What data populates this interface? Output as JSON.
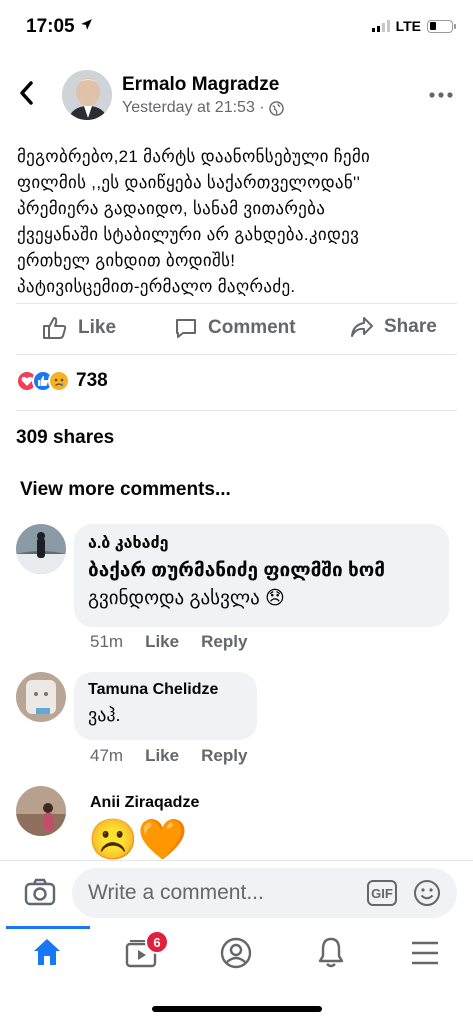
{
  "status": {
    "time": "17:05",
    "network": "LTE"
  },
  "post": {
    "author": "Ermalo Magradze",
    "timestamp": "Yesterday at 21:53 ·",
    "text_lines": [
      "მეგობრებო,21 მარტს დაანონსებული ჩემი",
      "ფილმის ,,ეს დაიწყება საქართველოდან''",
      "პრემიერა გადაიდო, სანამ ვითარება",
      "ქვეყანაში  სტაბილური არ გახდება.კიდევ",
      "ერთხელ  გიხდით ბოდიშს!",
      "პატივისცემით-ერმალო მაღრაძე."
    ]
  },
  "actions": {
    "like": "Like",
    "comment": "Comment",
    "share": "Share"
  },
  "stats": {
    "reaction_count": "738",
    "shares": "309 shares"
  },
  "view_more": "View more comments...",
  "comments": [
    {
      "name": "ა.ბ კახაძე",
      "text_line1": "ბაქარ თურმანიძე ფილმში ხომ",
      "text_line2": "გვინდოდა გასვლა",
      "emoji": "😞",
      "time": "51m",
      "like": "Like",
      "reply": "Reply"
    },
    {
      "name": "Tamuna Chelidze",
      "text_line1": "ვაჰ.",
      "time": "47m",
      "like": "Like",
      "reply": "Reply"
    },
    {
      "name": "Anii Ziraqadze",
      "emoji": "☹️🧡"
    }
  ],
  "composer": {
    "placeholder": "Write a comment...",
    "gif": "GIF"
  },
  "tabbar": {
    "video_badge": "6"
  },
  "colors": {
    "accent": "#1877f2",
    "badge": "#e41e3f",
    "secondary_text": "#65676b",
    "bubble": "#f0f2f5"
  }
}
